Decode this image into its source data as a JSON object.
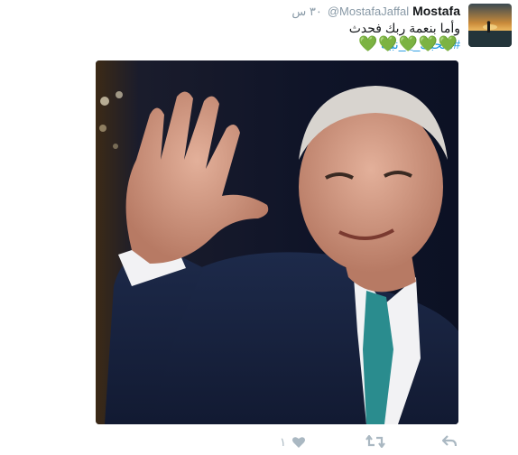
{
  "tweet": {
    "display_name": "Mostafa",
    "handle": "@MostafaJaffal",
    "timestamp": "٣٠ س",
    "text_line1": "وأما بنعمة ربك فحدث",
    "hashtag": "#منحبك_يا_نبيه",
    "emoji": "💚💚💚💚💚"
  },
  "actions": {
    "reply_icon": "reply-icon",
    "retweet_icon": "retweet-icon",
    "like_icon": "heart-icon",
    "like_count": "١"
  },
  "colors": {
    "name": "#14171a",
    "meta": "#8899a6",
    "link": "#1b95e0",
    "action": "#aab8c2"
  }
}
